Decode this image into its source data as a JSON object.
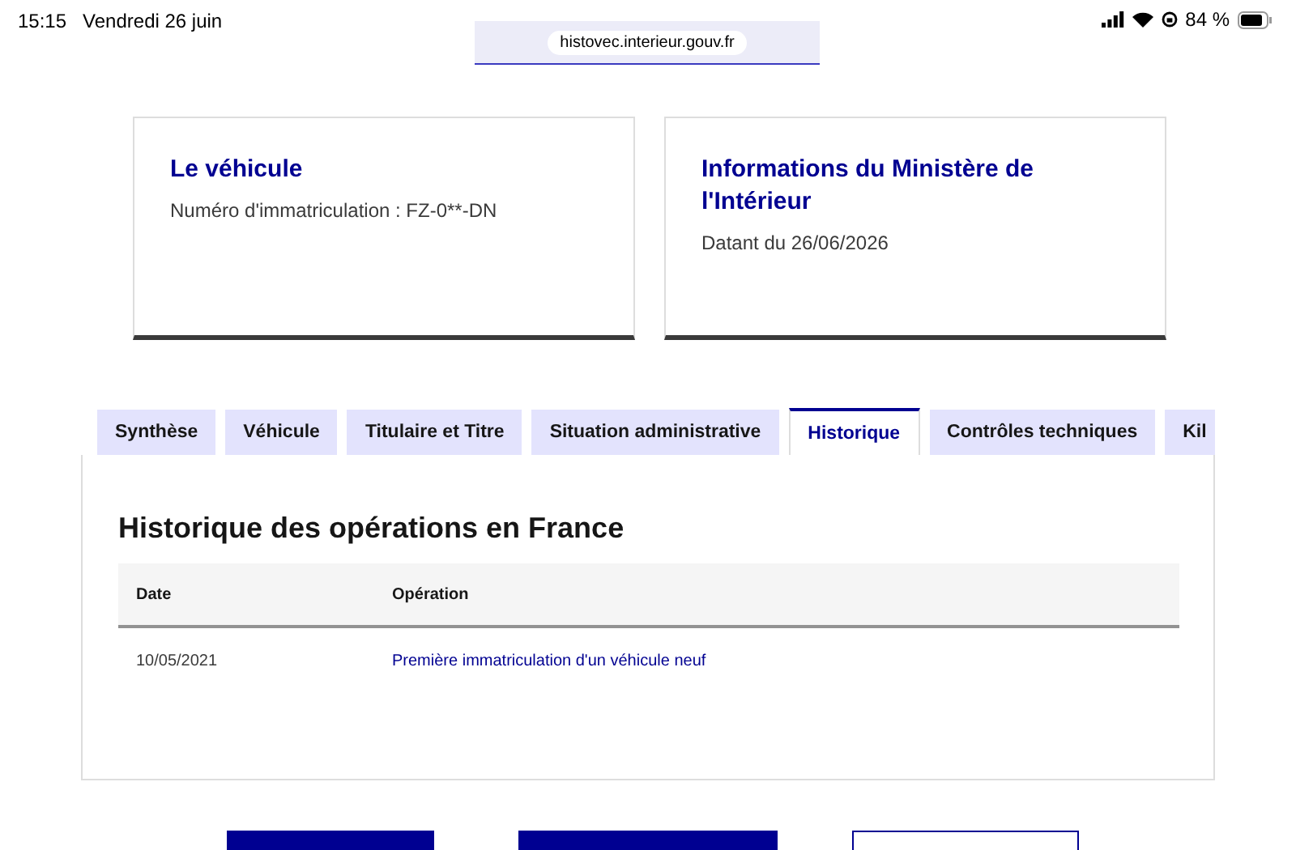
{
  "status_bar": {
    "time": "15:15",
    "date": "Vendredi 26 juin",
    "battery": "84 %"
  },
  "address_bar": {
    "url": "histovec.interieur.gouv.fr"
  },
  "cards": [
    {
      "title": "Le véhicule",
      "text": "Numéro d'immatriculation : FZ-0**-DN"
    },
    {
      "title": "Informations du Ministère de l'Intérieur",
      "text": "Datant du 26/06/2026"
    }
  ],
  "tabs": [
    {
      "label": "Synthèse",
      "selected": false
    },
    {
      "label": "Véhicule",
      "selected": false
    },
    {
      "label": "Titulaire et Titre",
      "selected": false
    },
    {
      "label": "Situation administrative",
      "selected": false
    },
    {
      "label": "Historique",
      "selected": true
    },
    {
      "label": "Contrôles techniques",
      "selected": false
    },
    {
      "label": "Kil",
      "selected": false
    }
  ],
  "panel": {
    "title": "Historique des opérations en France",
    "table": {
      "columns": [
        "Date",
        "Opération"
      ],
      "rows": [
        [
          "10/05/2021",
          "Première immatriculation d'un véhicule neuf"
        ]
      ]
    }
  },
  "buttons": [
    {
      "kind": "primary"
    },
    {
      "kind": "primary"
    },
    {
      "kind": "secondary"
    }
  ]
}
